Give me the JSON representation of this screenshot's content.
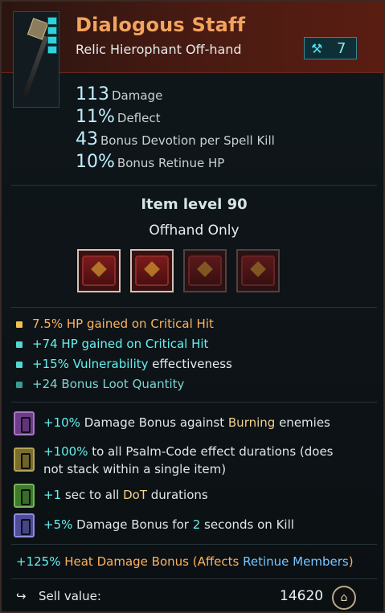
{
  "item": {
    "name": "Dialogous Staff",
    "type": "Relic Hierophant Off-hand",
    "badge_value": "7"
  },
  "stats": [
    {
      "value": "113",
      "label": "Damage"
    },
    {
      "value": "11%",
      "label": "Deflect"
    },
    {
      "value": "43",
      "label": "Bonus Devotion per Spell Kill"
    },
    {
      "value": "10%",
      "label": "Bonus Retinue HP"
    }
  ],
  "requirements": {
    "item_level": "Item level 90",
    "offhand_only": "Offhand Only"
  },
  "sockets": [
    {
      "state": "filled"
    },
    {
      "state": "filled"
    },
    {
      "state": "dim"
    },
    {
      "state": "dim"
    }
  ],
  "affixes": [
    {
      "text_a": "7.5% HP gained on Critical Hit",
      "color": "#ffb25c",
      "bullet": "#f2c24d"
    },
    {
      "text_a": "+74 HP gained on Critical Hit",
      "color": "#64f0ee",
      "bullet": "#52d7d2"
    },
    {
      "text_a": "+15%",
      "text_b": "Vulnerability",
      "text_c": "effectiveness",
      "color": "#64f0ee",
      "bullet": "#52d7d2"
    },
    {
      "text_a": "+24 Bonus Loot Quantity",
      "color": "#7bd5d0",
      "bullet": "#3a9b95"
    }
  ],
  "mods": [
    {
      "text_a": "+10%",
      "text_b": "Damage Bonus against",
      "text_c": "Burning",
      "text_d": "enemies",
      "icon": "purple"
    },
    {
      "line1_a": "+100%",
      "line1_b": "to all Psalm-Code effect durations (does",
      "line2": "not stack within a single item)",
      "icon": "olive"
    },
    {
      "text_a": "+1",
      "text_b": "sec to all",
      "text_c": "DoT",
      "text_d": "durations",
      "icon": "green"
    },
    {
      "text_a": "+5%",
      "text_b": "Damage Bonus for",
      "text_c": "2",
      "text_d": "seconds on Kill",
      "icon": "violet"
    }
  ],
  "heat_bonus": {
    "a": "+125%",
    "b": "Heat Damage Bonus (Affects",
    "c": "Retinue Members",
    "d": ")"
  },
  "sell": {
    "label": "Sell value:",
    "value": "14620"
  }
}
